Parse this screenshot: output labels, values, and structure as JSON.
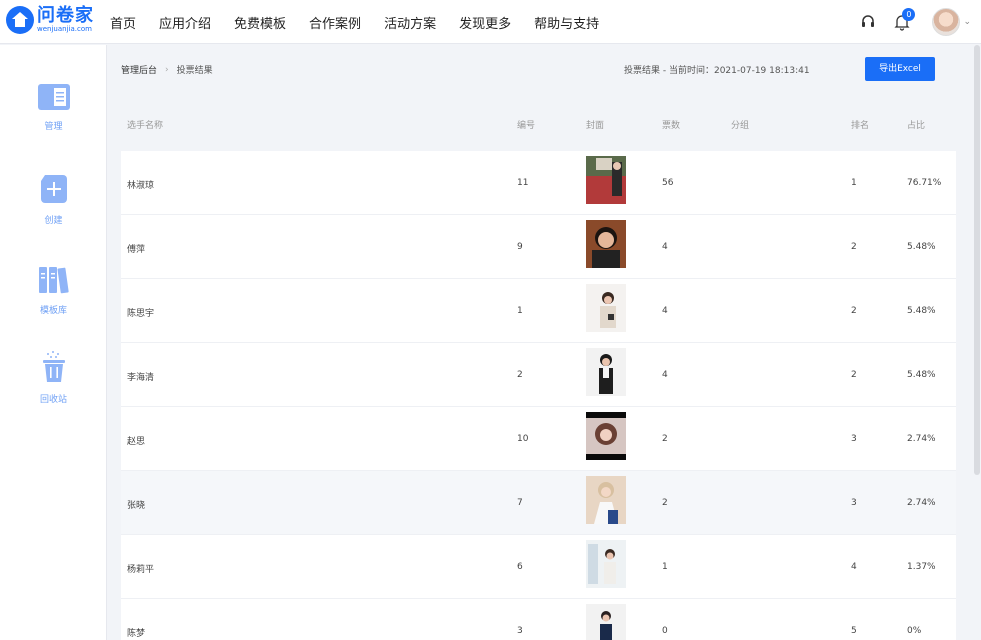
{
  "logo": {
    "cn": "问卷家",
    "en": "wenjuanjia.com"
  },
  "nav": [
    "首页",
    "应用介绍",
    "免费模板",
    "合作案例",
    "活动方案",
    "发现更多",
    "帮助与支持"
  ],
  "notifications": {
    "count": "0"
  },
  "sidebar": [
    {
      "label": "管理",
      "icon": "manage-icon"
    },
    {
      "label": "创建",
      "icon": "create-icon"
    },
    {
      "label": "模板库",
      "icon": "template-library-icon"
    },
    {
      "label": "回收站",
      "icon": "recycle-bin-icon"
    }
  ],
  "breadcrumb": {
    "root": "管理后台",
    "current": "投票结果"
  },
  "timeinfo": "投票结果 - 当前时间：2021-07-19 18:13:41",
  "export_label": "导出Excel",
  "columns": {
    "name": "选手名称",
    "number": "编号",
    "cover": "封面",
    "votes": "票数",
    "group": "分组",
    "rank": "排名",
    "ratio": "占比"
  },
  "rows": [
    {
      "name": "林淑琼",
      "number": "11",
      "votes": "56",
      "group": "",
      "rank": "1",
      "ratio": "76.71%"
    },
    {
      "name": "傅萍",
      "number": "9",
      "votes": "4",
      "group": "",
      "rank": "2",
      "ratio": "5.48%"
    },
    {
      "name": "陈思宇",
      "number": "1",
      "votes": "4",
      "group": "",
      "rank": "2",
      "ratio": "5.48%"
    },
    {
      "name": "李海清",
      "number": "2",
      "votes": "4",
      "group": "",
      "rank": "2",
      "ratio": "5.48%"
    },
    {
      "name": "赵思",
      "number": "10",
      "votes": "2",
      "group": "",
      "rank": "3",
      "ratio": "2.74%"
    },
    {
      "name": "张晓",
      "number": "7",
      "votes": "2",
      "group": "",
      "rank": "3",
      "ratio": "2.74%"
    },
    {
      "name": "杨莉平",
      "number": "6",
      "votes": "1",
      "group": "",
      "rank": "4",
      "ratio": "1.37%"
    },
    {
      "name": "陈梦",
      "number": "3",
      "votes": "0",
      "group": "",
      "rank": "5",
      "ratio": "0%"
    }
  ],
  "colors": {
    "accent": "#1a6ef7",
    "sidebar_icon": "#8fb4f7"
  }
}
